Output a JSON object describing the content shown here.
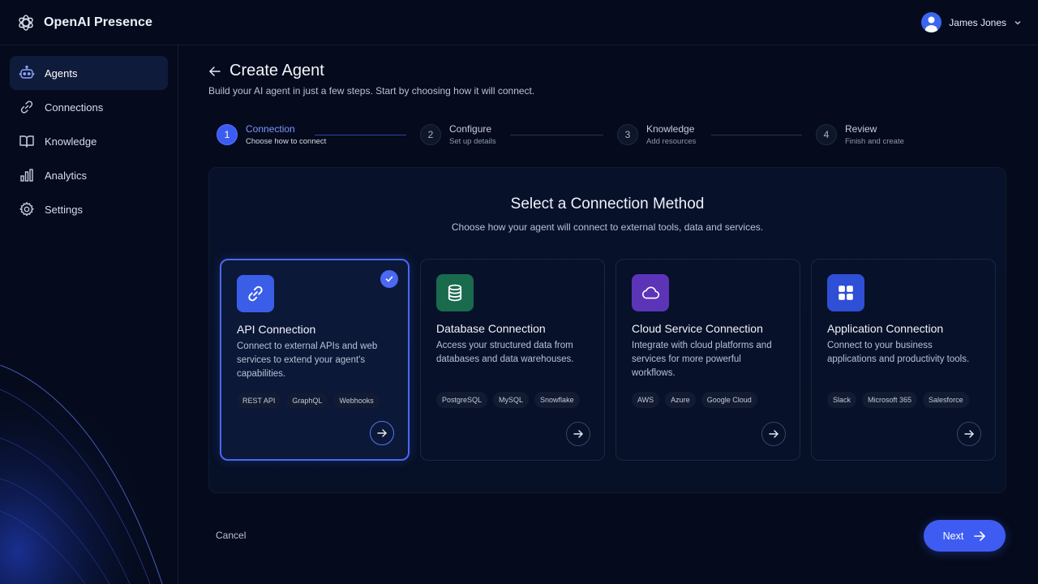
{
  "app": {
    "name": "OpenAI Presence"
  },
  "user": {
    "name": "James Jones"
  },
  "sidebar": {
    "items": [
      {
        "label": "Agents",
        "icon": "robot-icon",
        "active": true
      },
      {
        "label": "Connections",
        "icon": "link-icon",
        "active": false
      },
      {
        "label": "Knowledge",
        "icon": "book-icon",
        "active": false
      },
      {
        "label": "Analytics",
        "icon": "bar-chart-icon",
        "active": false
      },
      {
        "label": "Settings",
        "icon": "gear-icon",
        "active": false
      }
    ]
  },
  "header": {
    "title": "Create Agent",
    "subtitle": "Build your AI agent in just a few steps. Start by choosing how it will connect."
  },
  "stepper": {
    "steps": [
      {
        "num": "1",
        "title": "Connection",
        "sub": "Choose how to connect",
        "active": true
      },
      {
        "num": "2",
        "title": "Configure",
        "sub": "Set up details",
        "active": false
      },
      {
        "num": "3",
        "title": "Knowledge",
        "sub": "Add resources",
        "active": false
      },
      {
        "num": "4",
        "title": "Review",
        "sub": "Finish and create",
        "active": false
      }
    ]
  },
  "panel": {
    "title": "Select a Connection Method",
    "subtitle": "Choose how your agent will connect to external tools, data and services."
  },
  "cards": [
    {
      "title": "API Connection",
      "desc": "Connect to external APIs and web services to extend your agent's capabilities.",
      "tags": [
        "REST API",
        "GraphQL",
        "Webhooks"
      ],
      "icon": "link-icon",
      "icon_bg": "#3b5ee8",
      "selected": true
    },
    {
      "title": "Database Connection",
      "desc": "Access your structured data from databases and data warehouses.",
      "tags": [
        "PostgreSQL",
        "MySQL",
        "Snowflake"
      ],
      "icon": "database-icon",
      "icon_bg": "#1a6a4e",
      "selected": false
    },
    {
      "title": "Cloud Service Connection",
      "desc": "Integrate with cloud platforms and services for more powerful workflows.",
      "tags": [
        "AWS",
        "Azure",
        "Google Cloud"
      ],
      "icon": "cloud-icon",
      "icon_bg": "#5b34b8",
      "selected": false
    },
    {
      "title": "Application Connection",
      "desc": "Connect to your business applications and productivity tools.",
      "tags": [
        "Slack",
        "Microsoft 365",
        "Salesforce"
      ],
      "icon": "grid-icon",
      "icon_bg": "#2f4fd6",
      "selected": false
    }
  ],
  "footer": {
    "cancel": "Cancel",
    "next": "Next"
  },
  "colors": {
    "accent": "#3e5cf2",
    "background": "#050b1c"
  }
}
